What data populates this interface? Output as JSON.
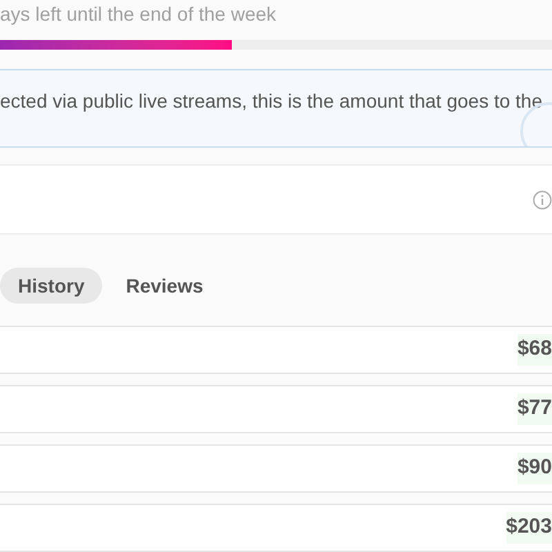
{
  "goal": {
    "caption": "ays left until the end of the week",
    "level": 0.42
  },
  "notice": {
    "text": "ected via public live streams, this is the amount that goes to the"
  },
  "tabs": [
    {
      "label": "History",
      "selected": true
    },
    {
      "label": "Reviews",
      "selected": false
    }
  ],
  "rows": [
    {
      "amount": "$68"
    },
    {
      "amount": "$77"
    },
    {
      "amount": "$90"
    },
    {
      "amount": "$203"
    }
  ]
}
